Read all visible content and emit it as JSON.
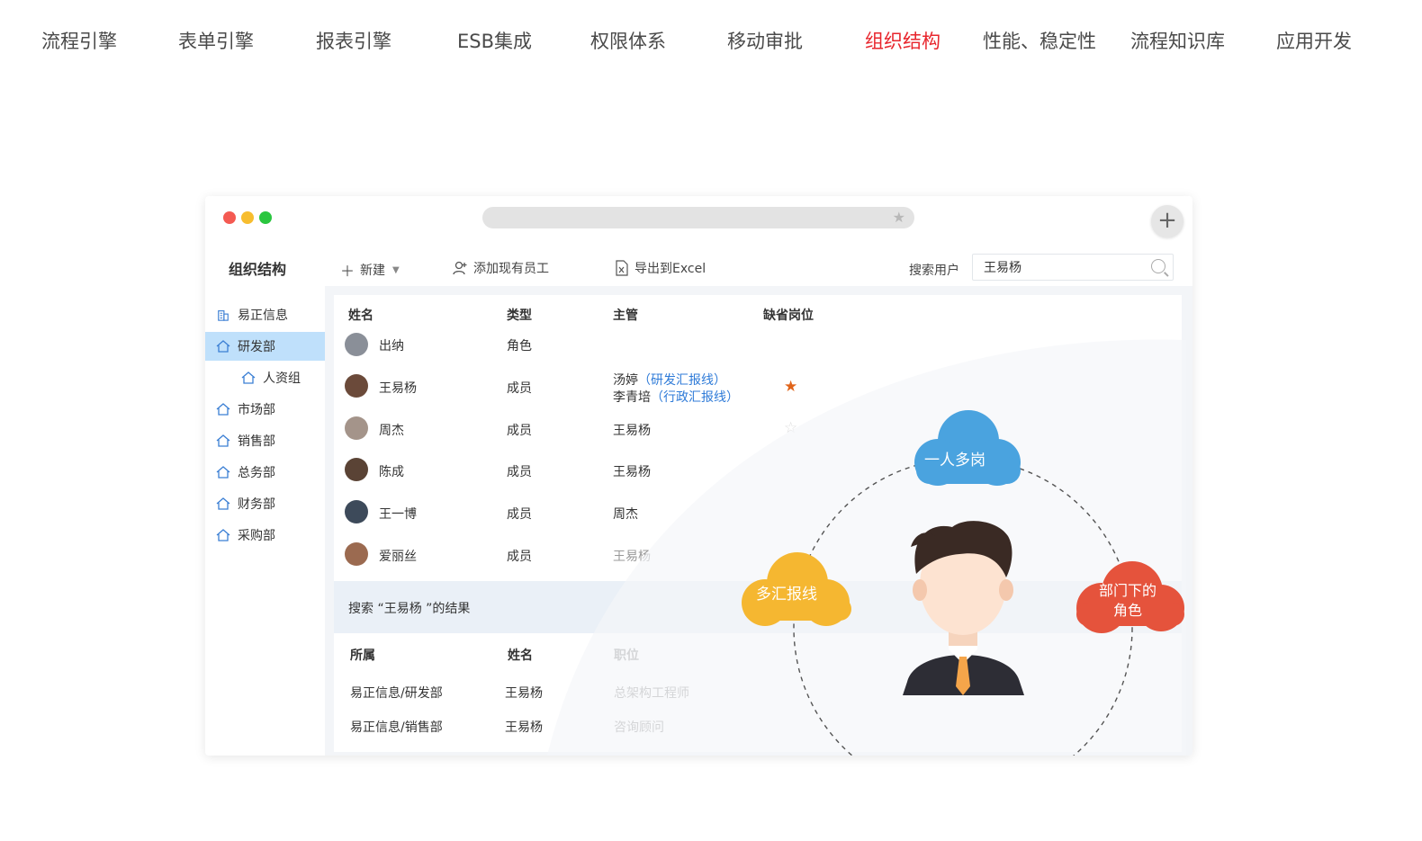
{
  "topnav": {
    "items": [
      {
        "label": "流程引擎"
      },
      {
        "label": "表单引擎"
      },
      {
        "label": "报表引擎"
      },
      {
        "label": "ESB集成"
      },
      {
        "label": "权限体系"
      },
      {
        "label": "移动审批"
      },
      {
        "label": "组织结构"
      },
      {
        "label": "性能、稳定性"
      },
      {
        "label": "流程知识库"
      },
      {
        "label": "应用开发"
      }
    ],
    "active_index": 6,
    "active_color": "#e8262d"
  },
  "window": {
    "add_button": "+",
    "sidebar_title": "组织结构",
    "toolbar": {
      "new_label": "新建",
      "add_existing_label": "添加现有员工",
      "export_label": "导出到Excel",
      "search_label": "搜索用户",
      "search_value": "王易杨"
    },
    "sidebar": {
      "items": [
        {
          "label": "易正信息",
          "icon": "building-icon"
        },
        {
          "label": "研发部",
          "icon": "home-icon"
        },
        {
          "label": "人资组",
          "icon": "home-icon"
        },
        {
          "label": "市场部",
          "icon": "home-icon"
        },
        {
          "label": "销售部",
          "icon": "home-icon"
        },
        {
          "label": "总务部",
          "icon": "home-icon"
        },
        {
          "label": "财务部",
          "icon": "home-icon"
        },
        {
          "label": "采购部",
          "icon": "home-icon"
        }
      ],
      "active_index": 1
    },
    "members_table": {
      "headers": [
        "姓名",
        "类型",
        "主管",
        "缺省岗位"
      ],
      "rows": [
        {
          "name": "出纳",
          "type": "角色",
          "manager": ""
        },
        {
          "name": "王易杨",
          "type": "成员",
          "manager": "汤婷",
          "manager_note": "（研发汇报线）",
          "manager2": "李青培",
          "manager2_note": "（行政汇报线）",
          "default_post": "filled-star"
        },
        {
          "name": "周杰",
          "type": "成员",
          "manager": "王易杨",
          "default_post": "empty-star"
        },
        {
          "name": "陈成",
          "type": "成员",
          "manager": "王易杨"
        },
        {
          "name": "王一博",
          "type": "成员",
          "manager": "周杰"
        },
        {
          "name": "爱丽丝",
          "type": "成员",
          "manager": "王易杨"
        }
      ]
    },
    "search_result": {
      "title": "搜索 “王易杨 ”的结果",
      "headers": [
        "所属",
        "姓名",
        "职位"
      ],
      "rows": [
        {
          "dept": "易正信息/研发部",
          "name": "王易杨",
          "position": "总架构工程师"
        },
        {
          "dept": "易正信息/销售部",
          "name": "王易杨",
          "position": "咨询顾问"
        }
      ]
    },
    "illustration": {
      "clouds": [
        {
          "label": "一人多岗",
          "color": "#4aa3df"
        },
        {
          "label": "多汇报线",
          "color": "#f5b731"
        },
        {
          "label": "部门下的",
          "label2": "角色",
          "color": "#e5533c"
        }
      ]
    }
  },
  "colors": {
    "link": "#2f7bd8",
    "sidebar_active": "#bfe0fb",
    "star": "#e0641a"
  }
}
